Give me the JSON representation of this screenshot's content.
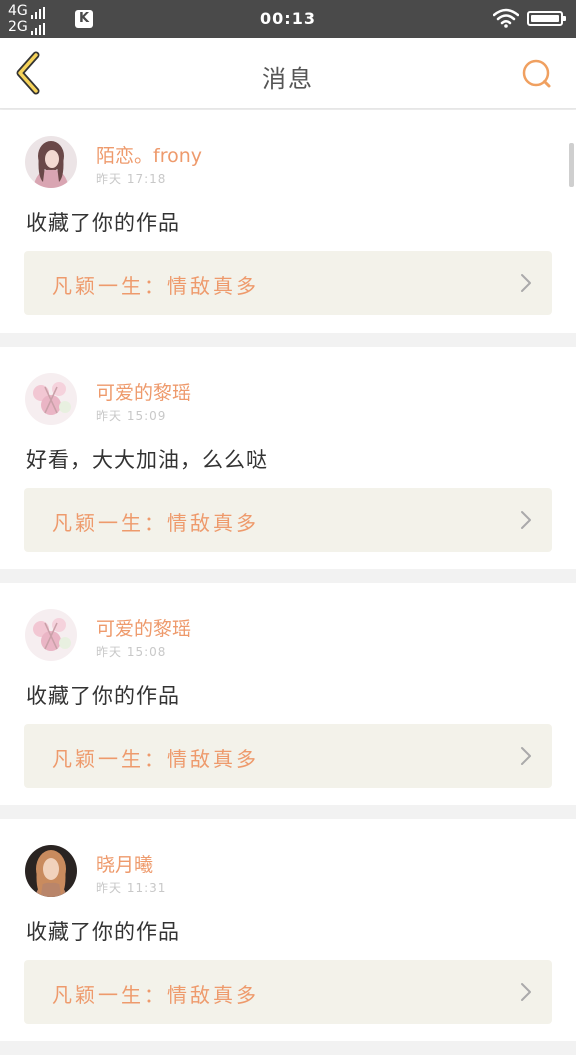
{
  "status_bar": {
    "net_top": "4G",
    "net_bottom": "2G",
    "app_icon_letter": "K",
    "time": "00:13"
  },
  "header": {
    "title": "消息",
    "back_icon": "chevron-left-icon",
    "search_icon": "search-icon",
    "accent_color": "#f0a060"
  },
  "messages": [
    {
      "username": "陌恋。frony",
      "time": "昨天 17:18",
      "comment": "收藏了你的作品",
      "work_title": "凡颖一生：情敌真多"
    },
    {
      "username": "可爱的黎瑶",
      "time": "昨天 15:09",
      "comment": "好看，大大加油，么么哒",
      "work_title": "凡颖一生：情敌真多"
    },
    {
      "username": "可爱的黎瑶",
      "time": "昨天 15:08",
      "comment": "收藏了你的作品",
      "work_title": "凡颖一生：情敌真多"
    },
    {
      "username": "晓月曦",
      "time": "昨天 11:31",
      "comment": "收藏了你的作品",
      "work_title": "凡颖一生：情敌真多"
    }
  ],
  "colors": {
    "username": "#ee9a6c",
    "link_bg": "#f3f2ea",
    "status_bar_bg": "#4a4a4a"
  }
}
